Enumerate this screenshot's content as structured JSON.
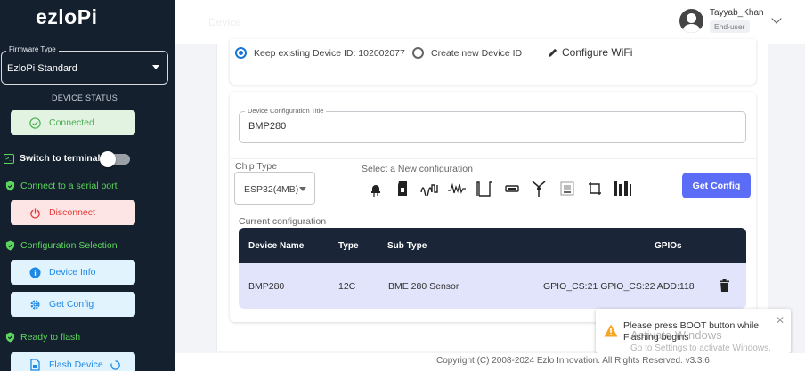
{
  "sidebar": {
    "logo": "ezloPi",
    "firmware": {
      "legend": "Firmware Type",
      "value": "EzloPi Standard"
    },
    "device_status_label": "DEVICE STATUS",
    "connected_label": "Connected",
    "switch_terminal_label": "Switch to terminal",
    "connect_serial_label": "Connect to a serial port",
    "disconnect_label": "Disconnect",
    "config_selection_label": "Configuration Selection",
    "device_info_label": "Device Info",
    "get_config_label": "Get Config",
    "ready_flash_label": "Ready to flash",
    "flash_device_label": "Flash Device"
  },
  "header": {
    "ghost_text": "Device",
    "user_name": "Tayyab_Khan",
    "user_role": "End-user"
  },
  "device_id": {
    "keep_label": "Keep existing Device ID: 102002077",
    "create_label": "Create new Device ID",
    "configure_wifi_label": "Configure WiFi"
  },
  "config": {
    "title_legend": "Device Configuration Title",
    "title_value": "BMP280",
    "chip_type_label": "Chip Type",
    "chip_type_value": "ESP32(4MB)",
    "select_new_label": "Select a New configuration",
    "get_config_button": "Get Config",
    "current_label": "Current configuration",
    "table": {
      "headers": [
        "Device Name",
        "Type",
        "Sub Type",
        "GPIOs"
      ],
      "rows": [
        {
          "device_name": "BMP280",
          "type": "12C",
          "sub_type": "BME 280 Sensor",
          "gpios": "GPIO_CS:21 GPIO_CS:22 ADD:118"
        }
      ]
    }
  },
  "toast": {
    "message": "Please press BOOT button while Flashing begins"
  },
  "watermark": {
    "line1": "Activate Windows",
    "line2": "Go to Settings to activate Windows."
  },
  "footer": {
    "copyright": "Copyright (C) 2008-2024 Ezlo Innovation. All Rights Reserved. v3.3.6"
  },
  "colors": {
    "sidebar_bg": "#14202e",
    "accent_green": "#5cd65c",
    "primary_button": "#5b6cf7",
    "table_header": "#1a2638",
    "table_row": "#e2e4fb"
  }
}
